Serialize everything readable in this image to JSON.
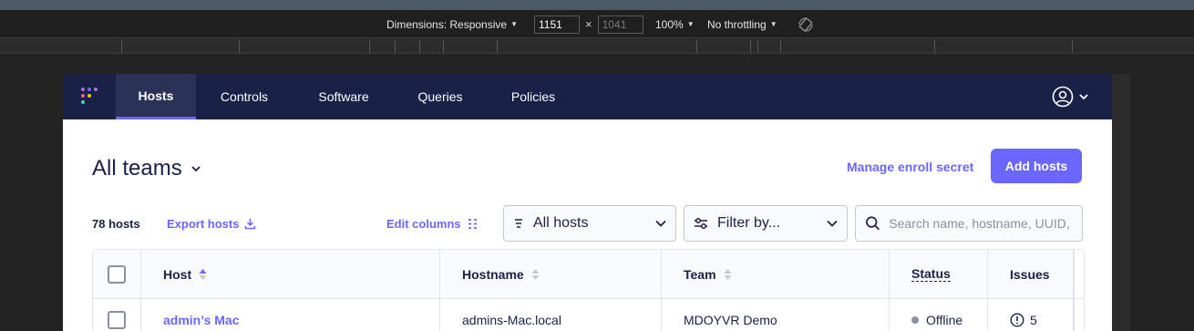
{
  "devtools": {
    "dimensions_label": "Dimensions: Responsive",
    "width_value": "1151",
    "height_value": "1041",
    "dimension_separator": "×",
    "zoom": "100%",
    "throttling": "No throttling"
  },
  "nav": {
    "tabs": [
      {
        "label": "Hosts",
        "active": true
      },
      {
        "label": "Controls"
      },
      {
        "label": "Software"
      },
      {
        "label": "Queries"
      },
      {
        "label": "Policies"
      }
    ]
  },
  "header": {
    "team_selector": "All teams",
    "manage_enroll_secret": "Manage enroll secret",
    "add_hosts": "Add hosts"
  },
  "toolbar": {
    "host_count": "78 hosts",
    "export_hosts": "Export hosts",
    "edit_columns": "Edit columns",
    "status_filter": "All hosts",
    "filter_by": "Filter by...",
    "search_placeholder": "Search name, hostname, UUID, serial number, or private IP address"
  },
  "table": {
    "columns": [
      "Host",
      "Hostname",
      "Team",
      "Status",
      "Issues"
    ],
    "rows": [
      {
        "host": "admin’s Mac",
        "hostname": "admins-Mac.local",
        "team": "MDOYVR Demo",
        "status": "Offline",
        "issues": "5"
      }
    ]
  },
  "colors": {
    "nav_bg": "#192147",
    "accent": "#6a67fe",
    "offline_dot": "#8b8fa2"
  }
}
